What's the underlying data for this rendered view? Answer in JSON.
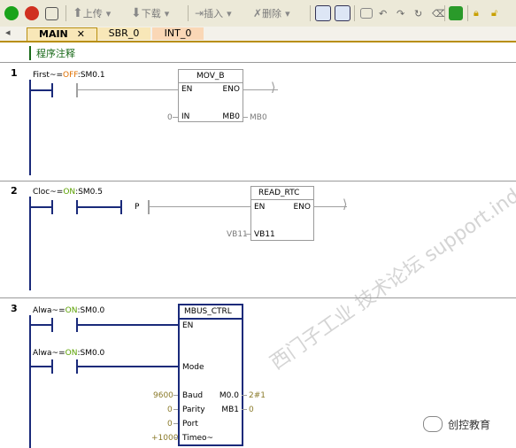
{
  "toolbar": {
    "upload_label": "上传",
    "download_label": "下载",
    "insert_label": "插入",
    "delete_label": "删除"
  },
  "tabs": [
    {
      "label": "MAIN"
    },
    {
      "label": "SBR_0"
    },
    {
      "label": "INT_0"
    }
  ],
  "comment": "程序注释",
  "networks": [
    {
      "number": "1",
      "contact": {
        "name": "First~",
        "eq": "=",
        "state": "OFF",
        "addr": ":SM0.1"
      },
      "box": {
        "title": "MOV_B",
        "en": "EN",
        "eno": "ENO",
        "in": "IN",
        "in_val": "0",
        "out": "MB0",
        "out_val": "MB0"
      }
    },
    {
      "number": "2",
      "contact": {
        "name": "Cloc~",
        "eq": "=",
        "state": "ON",
        "addr": ":SM0.5"
      },
      "p_label": "P",
      "box": {
        "title": "READ_RTC",
        "en": "EN",
        "eno": "ENO",
        "in": "VB11",
        "in_val": "VB11"
      }
    },
    {
      "number": "3",
      "contact1": {
        "name": "Alwa~",
        "eq": "=",
        "state": "ON",
        "addr": ":SM0.0"
      },
      "contact2": {
        "name": "Alwa~",
        "eq": "=",
        "state": "ON",
        "addr": ":SM0.0"
      },
      "box": {
        "title": "MBUS_CTRL",
        "en": "EN",
        "mode": "Mode",
        "baud": "Baud",
        "baud_val": "9600",
        "parity": "Parity",
        "parity_val": "0",
        "port": "Port",
        "port_val": "0",
        "timeout": "Timeo~",
        "timeout_val": "+1000",
        "done": "M0.0",
        "done_val": "2#1",
        "error": "MB1",
        "error_val": "0"
      }
    }
  ],
  "watermark": "西门子工业 技术论坛 support.industry.siemens.com/cs",
  "brand": "创控教育"
}
